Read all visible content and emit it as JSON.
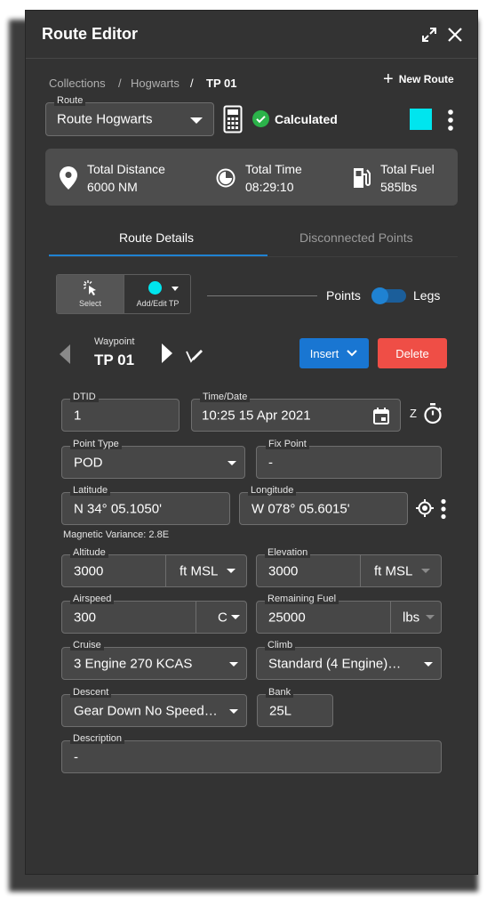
{
  "window": {
    "title": "Route Editor"
  },
  "breadcrumb": {
    "items": [
      "Collections",
      "Hogwarts"
    ],
    "current": "TP 01",
    "separator": "/"
  },
  "header_actions": {
    "new_route": "New Route"
  },
  "route_select": {
    "label": "Route",
    "value": "Route Hogwarts"
  },
  "status": {
    "text": "Calculated",
    "color": "#2bb34a"
  },
  "route_color": "#00e5ee",
  "stats": {
    "distance": {
      "label": "Total Distance",
      "value": "6000 NM"
    },
    "time": {
      "label": "Total Time",
      "value": "08:29:10"
    },
    "fuel": {
      "label": "Total Fuel",
      "value": "585lbs"
    }
  },
  "tabs": [
    {
      "label": "Route Details",
      "active": true
    },
    {
      "label": "Disconnected Points",
      "active": false
    }
  ],
  "tools": {
    "select": "Select",
    "add_edit": "Add/Edit TP",
    "tp_color": "#00e5ee"
  },
  "toggle": {
    "left": "Points",
    "right": "Legs",
    "state": "Points"
  },
  "waypoint": {
    "label": "Waypoint",
    "name": "TP 01"
  },
  "buttons": {
    "insert": "Insert",
    "delete": "Delete"
  },
  "form": {
    "dtid": {
      "label": "DTID",
      "value": "1"
    },
    "time_date": {
      "label": "Time/Date",
      "value": "10:25 15 Apr 2021",
      "zone": "Z"
    },
    "point_type": {
      "label": "Point Type",
      "value": "POD"
    },
    "fix_point": {
      "label": "Fix Point",
      "value": "-"
    },
    "latitude": {
      "label": "Latitude",
      "value": "N 34° 05.1050'"
    },
    "longitude": {
      "label": "Longitude",
      "value": "W 078° 05.6015'"
    },
    "magnetic_variance": "Magnetic Variance: 2.8E",
    "altitude": {
      "label": "Altitude",
      "value": "3000",
      "unit": "ft MSL"
    },
    "elevation": {
      "label": "Elevation",
      "value": "3000",
      "unit": "ft MSL"
    },
    "airspeed": {
      "label": "Airspeed",
      "value": "300",
      "unit": "C"
    },
    "remaining_fuel": {
      "label": "Remaining Fuel",
      "value": "25000",
      "unit": "lbs"
    },
    "cruise": {
      "label": "Cruise",
      "value": "3 Engine 270 KCAS"
    },
    "climb": {
      "label": "Climb",
      "value": "Standard (4 Engine)…"
    },
    "descent": {
      "label": "Descent",
      "value": "Gear Down No Speed…"
    },
    "bank": {
      "label": "Bank",
      "value": "25L"
    },
    "description": {
      "label": "Description",
      "value": "-"
    }
  }
}
